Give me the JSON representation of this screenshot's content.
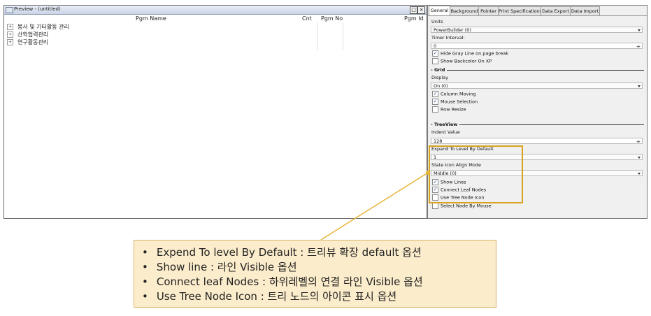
{
  "preview": {
    "title": "Preview - (untitled)",
    "columns": {
      "pgm_name": "Pgm Name",
      "cnt": "Cnt",
      "pgm_no": "Pgm No",
      "pgm_id": "Pgm Id"
    },
    "buttons": {
      "restore": "□",
      "close": "×"
    },
    "tree_items": [
      "봉사 및 기타활동 관리",
      "산학협력관리",
      "연구활동관리"
    ],
    "expander": "+"
  },
  "panel": {
    "tabs": [
      "General",
      "Background",
      "Pointer",
      "Print Specifications",
      "Data Export",
      "Data Import"
    ],
    "active_tab": "General",
    "units_label": "Units",
    "units_value": "PowerBuilder (0)",
    "timer_label": "Timer Interval:",
    "timer_value": "0",
    "hide_gray_line": "Hide Gray Line on page break",
    "show_backcolor": "Show Backcolor On XP",
    "grid_section": "Grid",
    "display_label": "Display",
    "display_value": "On (0)",
    "column_moving": "Column Moving",
    "mouse_selection": "Mouse Selection",
    "row_resize": "Row Resize",
    "treeview_section": "TreeView",
    "indent_label": "Indent Value",
    "indent_value": "128",
    "expand_label": "Expand To Level By Default",
    "expand_value": "1",
    "state_icon_label": "State Icon Align Mode",
    "state_icon_value": "Middle (0)",
    "show_lines": "Show Lines",
    "connect_leaf": "Connect Leaf Nodes",
    "use_tree_icon": "Use Tree Node Icon",
    "select_node_mouse": "Select Node By Mouse",
    "check_mark": "✓",
    "section_prefix": "-"
  },
  "checkbox_states": {
    "hide_gray_line": true,
    "show_backcolor": false,
    "column_moving": true,
    "mouse_selection": true,
    "row_resize": false,
    "show_lines": true,
    "connect_leaf": true,
    "use_tree_icon": false,
    "select_node_mouse": false
  },
  "callout": {
    "items": [
      "Expend To level By Default : 트리뷰 확장 default 옵션",
      "Show line : 라인 Visible 옵션",
      "Connect leaf Nodes : 하위레벨의 연결 라인 Visible 옵션",
      "Use Tree Node Icon : 트리 노드의 아이콘 표시 옵션"
    ]
  },
  "colors": {
    "highlight": "#d6a421",
    "callout_bg": "#fbeccb",
    "pointer_line": "#e6b53a"
  }
}
